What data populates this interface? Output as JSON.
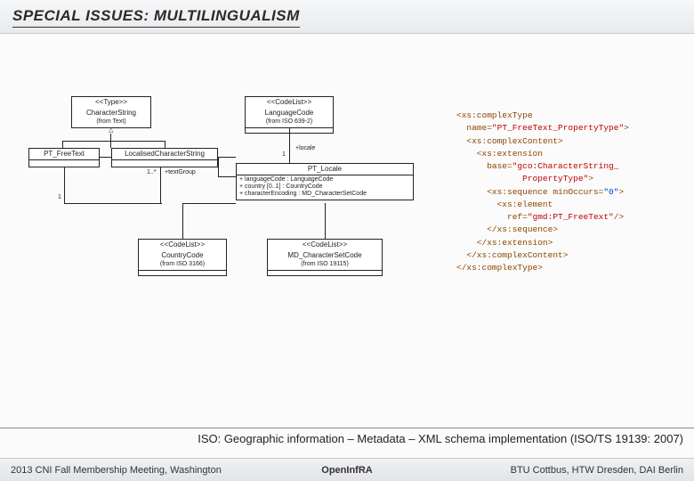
{
  "header": {
    "title": "SPECIAL  ISSUES: MULTILINGUALISM"
  },
  "uml": {
    "characterString": {
      "stereo": "<<Type>>",
      "name": "CharacterString",
      "from": "(from Text)"
    },
    "ptFreeText": {
      "name": "PT_FreeText"
    },
    "localisedCharString": {
      "name": "LocalisedCharacterString"
    },
    "languageCode": {
      "stereo": "<<CodeList>>",
      "name": "LanguageCode",
      "from": "(from ISO 639-2)"
    },
    "ptLocale": {
      "name": "PT_Locale",
      "attrs": "+ languageCode : LanguageCode\n+ country [0..1] : CountryCode\n+ characterEncoding : MD_CharacterSetCode"
    },
    "countryCode": {
      "stereo": "<<CodeList>>",
      "name": "CountryCode",
      "from": "(from ISO 3166)"
    },
    "mdCharSet": {
      "stereo": "<<CodeList>>",
      "name": "MD_CharacterSetCode",
      "from": "(from ISO 19115)"
    },
    "labels": {
      "one_a": "1",
      "one_b": "1",
      "many": "1..*",
      "textGroup": "+textGroup",
      "locale": "+locale"
    }
  },
  "xml": {
    "lines": [
      {
        "t": "brown",
        "s": "<xs:complexType"
      },
      {
        "t": "brown",
        "s": "  name="
      },
      {
        "t": "red",
        "s": "\"PT_FreeText_PropertyType\""
      },
      {
        "t": "brown",
        "s": ">"
      },
      {
        "t": "brown",
        "s": "  <xs:complexContent>"
      },
      {
        "t": "brown",
        "s": "    <xs:extension"
      },
      {
        "t": "brown",
        "s": "      base="
      },
      {
        "t": "red",
        "s": "\"gco:CharacterString_"
      },
      {
        "t": "red",
        "s": "             PropertyType\""
      },
      {
        "t": "brown",
        "s": ">"
      },
      {
        "t": "brown",
        "s": "      <xs:sequence minOccurs="
      },
      {
        "t": "blue",
        "s": "\"0\""
      },
      {
        "t": "brown",
        "s": ">"
      },
      {
        "t": "brown",
        "s": "        <xs:element"
      },
      {
        "t": "brown",
        "s": "          ref="
      },
      {
        "t": "red",
        "s": "\"gmd:PT_FreeText\""
      },
      {
        "t": "brown",
        "s": "/>"
      },
      {
        "t": "brown",
        "s": "      </xs:sequence>"
      },
      {
        "t": "brown",
        "s": "    </xs:extension>"
      },
      {
        "t": "brown",
        "s": "  </xs:complexContent>"
      },
      {
        "t": "brown",
        "s": "</xs:complexType>"
      }
    ]
  },
  "caption": "ISO: Geographic information – Metadata – XML schema implementation (ISO/TS 19139: 2007)",
  "footer": {
    "left": "2013 CNI Fall Membership Meeting, Washington",
    "center": "OpenInfRA",
    "right": "BTU Cottbus, HTW Dresden, DAI Berlin"
  }
}
